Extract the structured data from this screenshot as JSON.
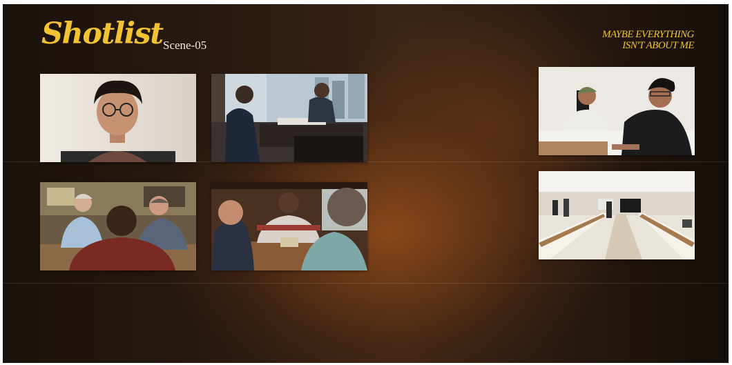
{
  "header": {
    "title": "Shotlist",
    "scene": "Scene-05",
    "tagline_line1": "MAYBE EVERYTHING",
    "tagline_line2": "ISN'T ABOUT ME"
  },
  "colors": {
    "accent": "#f1c232",
    "scene_text": "#f3ede6"
  },
  "shots": [
    {
      "id": "shot-1",
      "content": "young man with curly hair and glasses facing camera, plain wall"
    },
    {
      "id": "shot-2",
      "content": "office meeting at desk by large window, city skyline"
    },
    {
      "id": "shot-3",
      "content": "two young men seated at a table, one in green cap"
    },
    {
      "id": "shot-4",
      "content": "family around a kitchen table, older woman and older man"
    },
    {
      "id": "shot-5",
      "content": "three people at a wooden table facing a man in striped shirt"
    },
    {
      "id": "shot-6",
      "content": "meeting room with long tables, people standing near screen"
    }
  ]
}
